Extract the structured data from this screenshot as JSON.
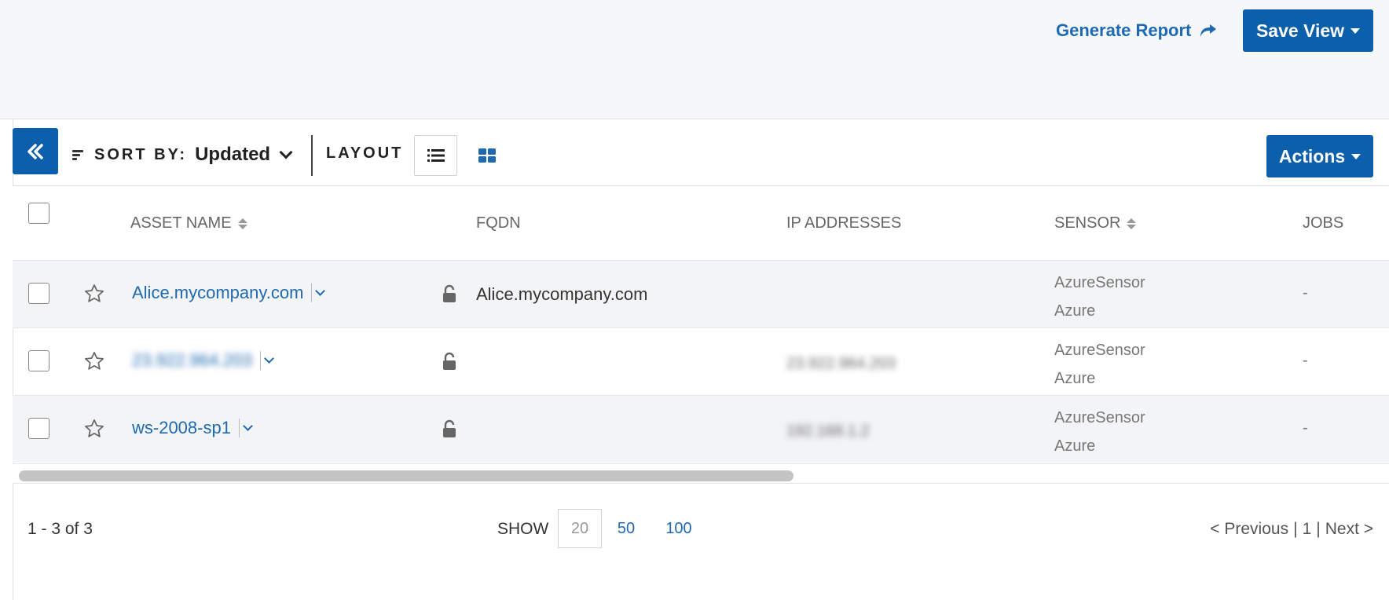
{
  "header": {
    "generate_report": "Generate Report",
    "save_view": "Save View"
  },
  "toolbar": {
    "sort_by_label": "SORT BY:",
    "sort_by_value": "Updated",
    "layout_label": "LAYOUT",
    "actions": "Actions"
  },
  "table": {
    "columns": {
      "asset_name": "ASSET NAME",
      "fqdn": "FQDN",
      "ip_addresses": "IP ADDRESSES",
      "sensor": "SENSOR",
      "jobs": "JOBS"
    },
    "rows": [
      {
        "asset_name": "Alice.mycompany.com",
        "fqdn": "Alice.mycompany.com",
        "ip": "",
        "sensor_line1": "AzureSensor",
        "sensor_line2": "Azure",
        "jobs": "-"
      },
      {
        "asset_name": "23.922.964.203",
        "fqdn": "",
        "ip": "23.922.964.203",
        "sensor_line1": "AzureSensor",
        "sensor_line2": "Azure",
        "jobs": "-"
      },
      {
        "asset_name": "ws-2008-sp1",
        "fqdn": "",
        "ip": "192.168.1.2",
        "sensor_line1": "AzureSensor",
        "sensor_line2": "Azure",
        "jobs": "-"
      }
    ]
  },
  "footer": {
    "range": "1 - 3 of 3",
    "show_label": "SHOW",
    "show_options": [
      "20",
      "50",
      "100"
    ],
    "pager": {
      "previous": "< Previous",
      "sep1": "|",
      "page": "1",
      "sep2": "|",
      "next": "Next >"
    }
  },
  "colors": {
    "primary": "#0b5fab",
    "link": "#1f69b0",
    "topbar_bg": "#f6f7f9",
    "row_shade": "#f3f4f6"
  },
  "icons": {
    "collapse": "double-chevron-left-icon",
    "sort": "sort-lines-icon",
    "list_layout": "list-layout-icon",
    "grid_layout": "grid-layout-icon",
    "star": "star-outline-icon",
    "lock": "unlocked-icon",
    "share": "share-arrow-icon"
  }
}
